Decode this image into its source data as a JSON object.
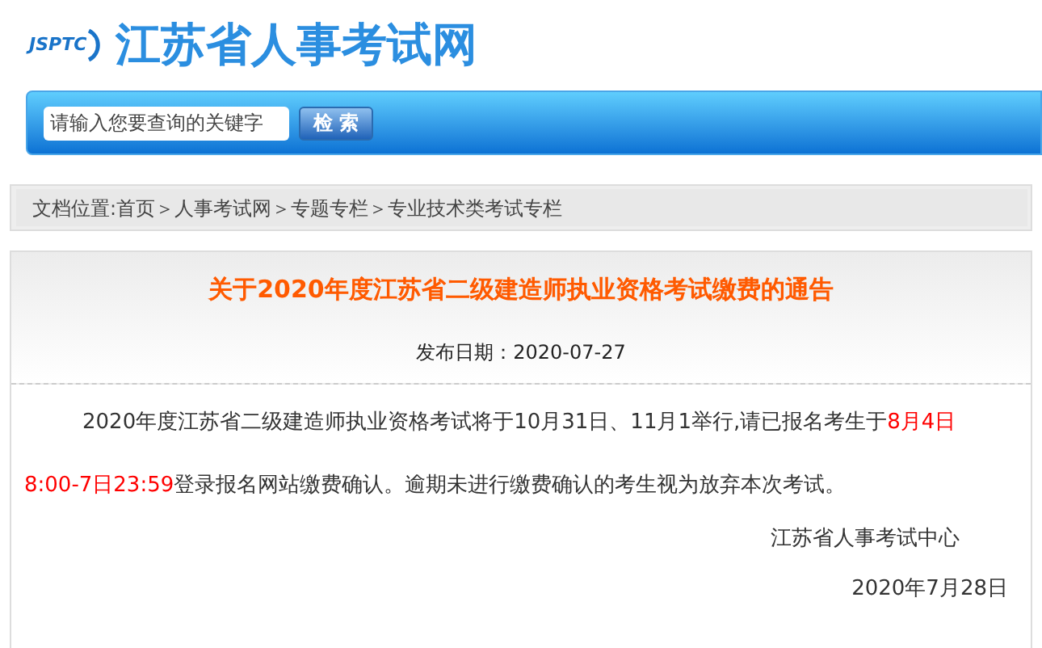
{
  "header": {
    "logo_mark": "JSPTC",
    "site_title": "江苏省人事考试网"
  },
  "search": {
    "placeholder": "请输入您要查询的关键字",
    "button": "检 索"
  },
  "breadcrumb": "文档位置:首页＞人事考试网＞专题专栏＞专业技术类考试专栏",
  "article": {
    "title": "关于2020年度江苏省二级建造师执业资格考试缴费的通告",
    "publish_date": "发布日期：2020-07-27",
    "paragraph": [
      {
        "text": "2020年度江苏省二级建造师执业资格考试将于10月31日、11月1举行,请已报名考生于",
        "highlight": false
      },
      {
        "text": "8月4日8:00-7日23:59",
        "highlight": true
      },
      {
        "text": "登录报名网站缴费确认。逾期未进行缴费确认的考生视为放弃本次考试。",
        "highlight": false
      }
    ],
    "signature": "江苏省人事考试中心",
    "date": "2020年7月28日"
  }
}
